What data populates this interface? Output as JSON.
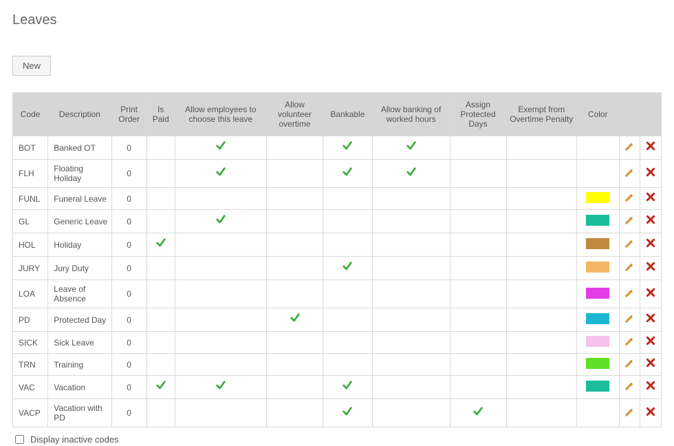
{
  "page": {
    "title": "Leaves"
  },
  "buttons": {
    "new": "New"
  },
  "columns": {
    "code": "Code",
    "description": "Description",
    "printOrder": "Print Order",
    "isPaid": "Is Paid",
    "allowChoose": "Allow employees to choose this leave",
    "allowVolunteer": "Allow volunteer overtime",
    "bankable": "Bankable",
    "allowBanking": "Allow banking of worked hours",
    "assignProtected": "Assign Protected Days",
    "exemptPenalty": "Exempt from Overtime Penalty",
    "color": "Color"
  },
  "footer": {
    "displayInactive": "Display inactive codes"
  },
  "rows": [
    {
      "code": "BOT",
      "description": "Banked OT",
      "printOrder": 0,
      "isPaid": false,
      "allowChoose": true,
      "allowVolunteer": false,
      "bankable": true,
      "allowBanking": true,
      "assignProtected": false,
      "exemptPenalty": false,
      "color": ""
    },
    {
      "code": "FLH",
      "description": "Floating Holiday",
      "printOrder": 0,
      "isPaid": false,
      "allowChoose": true,
      "allowVolunteer": false,
      "bankable": true,
      "allowBanking": true,
      "assignProtected": false,
      "exemptPenalty": false,
      "color": ""
    },
    {
      "code": "FUNL",
      "description": "Funeral Leave",
      "printOrder": 0,
      "isPaid": false,
      "allowChoose": false,
      "allowVolunteer": false,
      "bankable": false,
      "allowBanking": false,
      "assignProtected": false,
      "exemptPenalty": false,
      "color": "#ffff00"
    },
    {
      "code": "GL",
      "description": "Generic Leave",
      "printOrder": 0,
      "isPaid": false,
      "allowChoose": true,
      "allowVolunteer": false,
      "bankable": false,
      "allowBanking": false,
      "assignProtected": false,
      "exemptPenalty": false,
      "color": "#1bbc9b"
    },
    {
      "code": "HOL",
      "description": "Holiday",
      "printOrder": 0,
      "isPaid": true,
      "allowChoose": false,
      "allowVolunteer": false,
      "bankable": false,
      "allowBanking": false,
      "assignProtected": false,
      "exemptPenalty": false,
      "color": "#c08a3e"
    },
    {
      "code": "JURY",
      "description": "Jury Duty",
      "printOrder": 0,
      "isPaid": false,
      "allowChoose": false,
      "allowVolunteer": false,
      "bankable": true,
      "allowBanking": false,
      "assignProtected": false,
      "exemptPenalty": false,
      "color": "#f3b763"
    },
    {
      "code": "LOA",
      "description": "Leave of Absence",
      "printOrder": 0,
      "isPaid": false,
      "allowChoose": false,
      "allowVolunteer": false,
      "bankable": false,
      "allowBanking": false,
      "assignProtected": false,
      "exemptPenalty": false,
      "color": "#e33ee6"
    },
    {
      "code": "PD",
      "description": "Protected Day",
      "printOrder": 0,
      "isPaid": false,
      "allowChoose": false,
      "allowVolunteer": true,
      "bankable": false,
      "allowBanking": false,
      "assignProtected": false,
      "exemptPenalty": false,
      "color": "#1db7d4"
    },
    {
      "code": "SICK",
      "description": "Sick Leave",
      "printOrder": 0,
      "isPaid": false,
      "allowChoose": false,
      "allowVolunteer": false,
      "bankable": false,
      "allowBanking": false,
      "assignProtected": false,
      "exemptPenalty": false,
      "color": "#f4c2ec"
    },
    {
      "code": "TRN",
      "description": "Training",
      "printOrder": 0,
      "isPaid": false,
      "allowChoose": false,
      "allowVolunteer": false,
      "bankable": false,
      "allowBanking": false,
      "assignProtected": false,
      "exemptPenalty": false,
      "color": "#5fe024"
    },
    {
      "code": "VAC",
      "description": "Vacation",
      "printOrder": 0,
      "isPaid": true,
      "allowChoose": true,
      "allowVolunteer": false,
      "bankable": true,
      "allowBanking": false,
      "assignProtected": false,
      "exemptPenalty": false,
      "color": "#1bbc9b"
    },
    {
      "code": "VACP",
      "description": "Vacation with PD",
      "printOrder": 0,
      "isPaid": false,
      "allowChoose": false,
      "allowVolunteer": false,
      "bankable": true,
      "allowBanking": false,
      "assignProtected": true,
      "exemptPenalty": false,
      "color": ""
    }
  ]
}
